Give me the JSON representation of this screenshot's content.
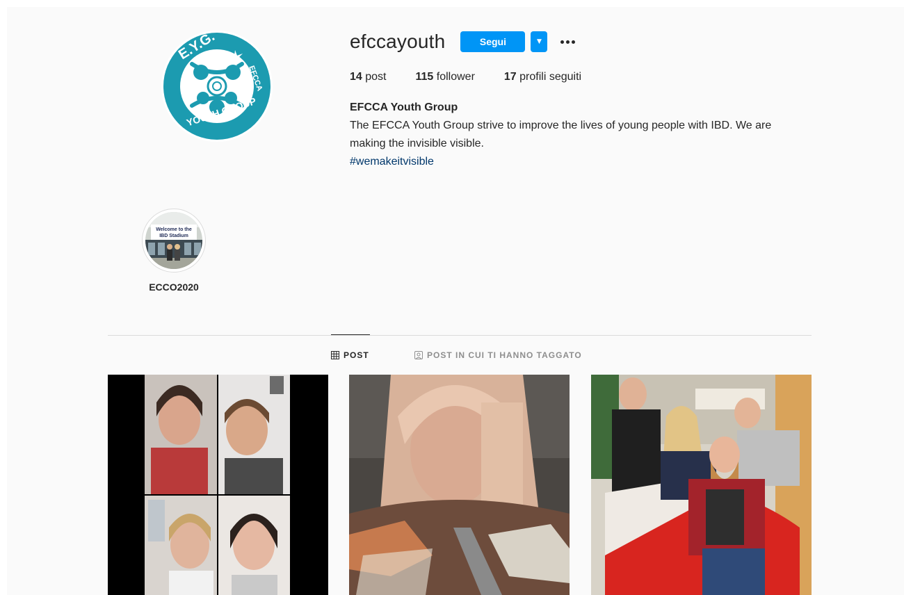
{
  "profile": {
    "username": "efccayouth",
    "follow_label": "Segui",
    "dropdown_label": "▼",
    "stats": {
      "posts_count": "14",
      "posts_label": "post",
      "followers_count": "115",
      "followers_label": "follower",
      "following_count": "17",
      "following_label": "profili seguiti"
    },
    "full_name": "EFCCA Youth Group",
    "bio": "The EFCCA Youth Group strive to improve the lives of young people with IBD. We are making the invisible visible.",
    "hashtag": "#wemakeitvisible"
  },
  "logo": {
    "top_text": "E.Y.G.",
    "side_text": "EFCCA",
    "bottom_text": "YOUTH GROUP",
    "color": "#1c9bb0"
  },
  "highlight": {
    "label": "ECCO2020",
    "sign_text_1": "Welcome to the",
    "sign_text_2": "IBD Stadium"
  },
  "tabs": {
    "posts_label": "POST",
    "tagged_label": "POST IN CUI TI HANNO TAGGATO"
  },
  "colors": {
    "accent": "#0095f6",
    "link": "#00376b",
    "background": "#fafafa"
  }
}
